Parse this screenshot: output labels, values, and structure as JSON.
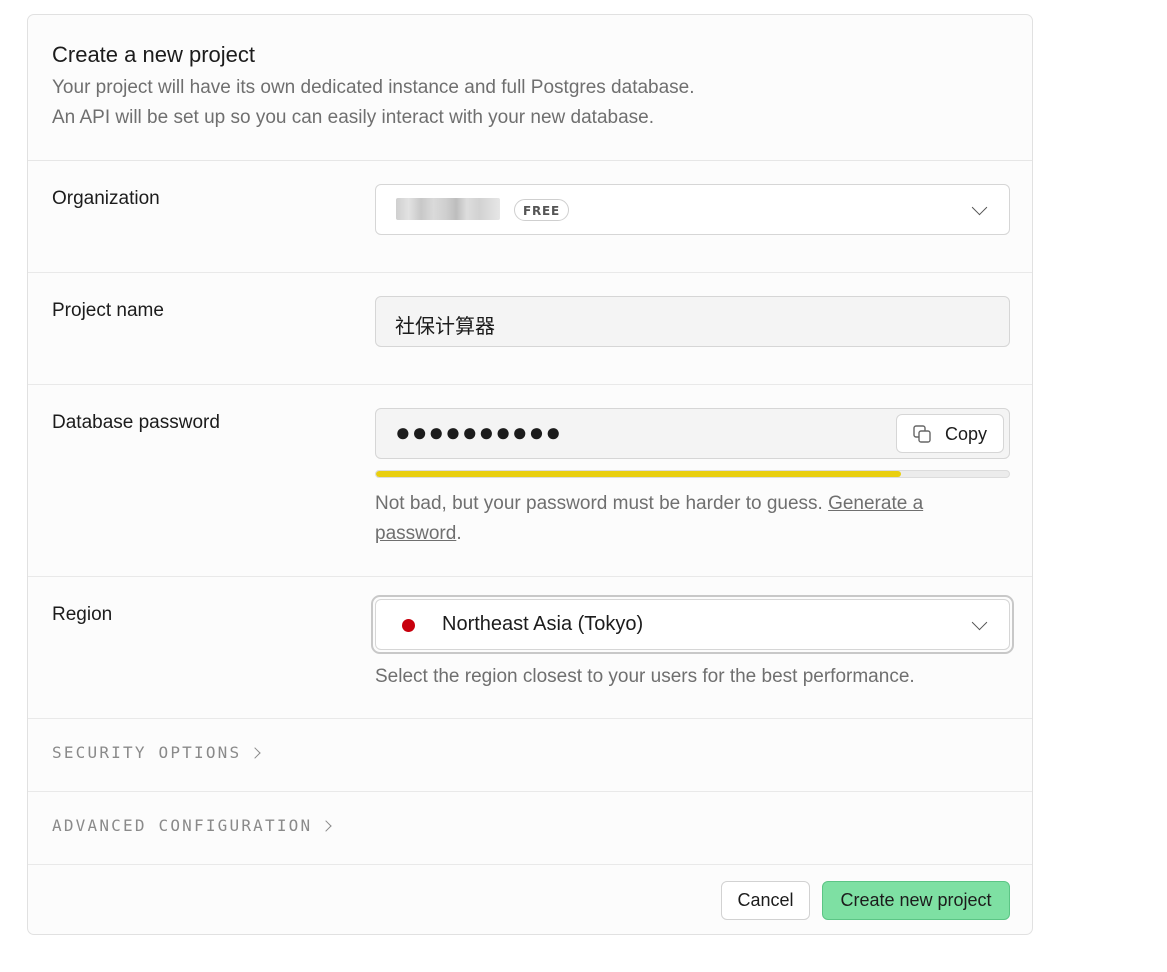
{
  "header": {
    "title": "Create a new project",
    "description_line1": "Your project will have its own dedicated instance and full Postgres database.",
    "description_line2": "An API will be set up so you can easily interact with your new database."
  },
  "organization": {
    "label": "Organization",
    "plan_badge": "FREE"
  },
  "project_name": {
    "label": "Project name",
    "value": "社保计算器"
  },
  "database_password": {
    "label": "Database password",
    "masked_value": "●●●●●●●●●●",
    "copy_label": "Copy",
    "strength_fraction": 0.83,
    "strength_color": "#e9cf0f",
    "hint_text": "Not bad, but your password must be harder to guess. ",
    "generate_link": "Generate a password",
    "hint_end": "."
  },
  "region": {
    "label": "Region",
    "value": "Northeast Asia (Tokyo)",
    "flag_color": "#c8000d",
    "help": "Select the region closest to your users for the best performance."
  },
  "sections": {
    "security": "SECURITY OPTIONS",
    "advanced": "ADVANCED CONFIGURATION"
  },
  "footer": {
    "cancel_label": "Cancel",
    "create_label": "Create new project",
    "create_color": "#7ee0a3"
  }
}
